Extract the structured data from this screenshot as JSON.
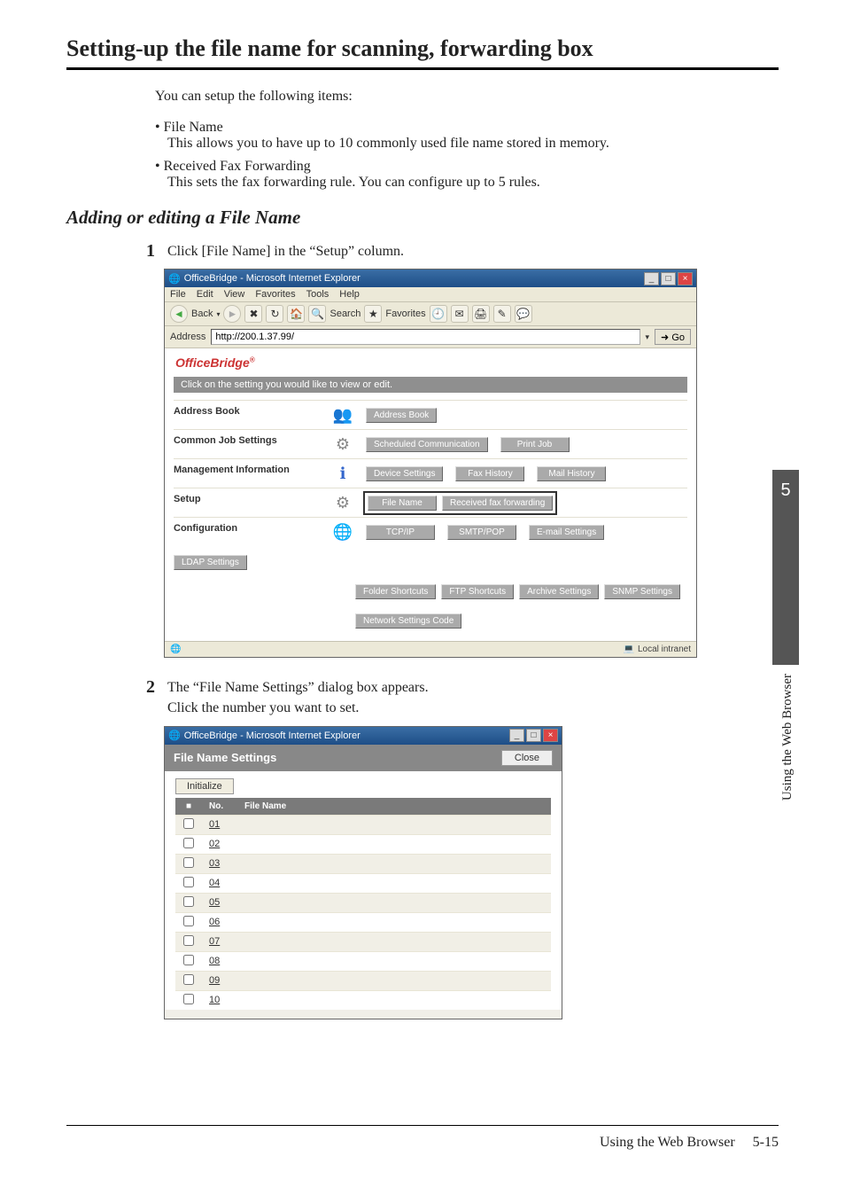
{
  "heading": "Setting-up the file name for scanning, forwarding box",
  "intro": "You can setup the following items:",
  "bullets": [
    {
      "head": "File Name",
      "desc": "This allows you to have up to 10 commonly used file name stored in memory."
    },
    {
      "head": "Received Fax Forwarding",
      "desc": "This sets the fax forwarding rule. You can configure up to 5 rules."
    }
  ],
  "subheading": "Adding or editing a File Name",
  "steps": [
    {
      "num": "1",
      "text": "Click [File Name] in the “Setup” column."
    },
    {
      "num": "2",
      "text": "The “File Name Settings” dialog box appears.\nClick the number you want to set."
    }
  ],
  "browser": {
    "title": "OfficeBridge - Microsoft Internet Explorer",
    "menus": {
      "file": "File",
      "edit": "Edit",
      "view": "View",
      "favorites": "Favorites",
      "tools": "Tools",
      "help": "Help"
    },
    "toolbar": {
      "back": "Back",
      "search": "Search",
      "favorites": "Favorites"
    },
    "address_label": "Address",
    "address_value": "http://200.1.37.99/",
    "go": "Go",
    "brand": "OfficeBridge",
    "clickbar": "Click on the setting you would like to view or edit.",
    "sections": {
      "address_book": {
        "label": "Address Book",
        "btn": "Address Book"
      },
      "common": {
        "label": "Common Job Settings",
        "btns": [
          "Scheduled Communication",
          "Print Job"
        ]
      },
      "mgmt": {
        "label": "Management Information",
        "btns": [
          "Device Settings",
          "Fax History",
          "Mail History"
        ]
      },
      "setup": {
        "label": "Setup",
        "btns": [
          "File Name",
          "Received fax forwarding"
        ]
      },
      "config": {
        "label": "Configuration",
        "row1": [
          "TCP/IP",
          "SMTP/POP",
          "E-mail Settings",
          "LDAP Settings"
        ],
        "row2": [
          "Folder Shortcuts",
          "FTP Shortcuts",
          "Archive Settings",
          "SNMP Settings"
        ],
        "row3": [
          "Network Settings Code"
        ]
      }
    },
    "status": "Local intranet"
  },
  "dialog": {
    "title": "File Name Settings",
    "close": "Close",
    "initialize": "Initialize",
    "headers": {
      "chk": "■",
      "no": "No.",
      "name": "File Name"
    },
    "rows": [
      {
        "no": "01",
        "name": ""
      },
      {
        "no": "02",
        "name": ""
      },
      {
        "no": "03",
        "name": ""
      },
      {
        "no": "04",
        "name": ""
      },
      {
        "no": "05",
        "name": ""
      },
      {
        "no": "06",
        "name": ""
      },
      {
        "no": "07",
        "name": ""
      },
      {
        "no": "08",
        "name": ""
      },
      {
        "no": "09",
        "name": ""
      },
      {
        "no": "10",
        "name": ""
      }
    ]
  },
  "sidebar": {
    "chapter": "5",
    "label": "Using the Web Browser"
  },
  "footer": {
    "section": "Using the Web Browser",
    "page": "5-15"
  }
}
